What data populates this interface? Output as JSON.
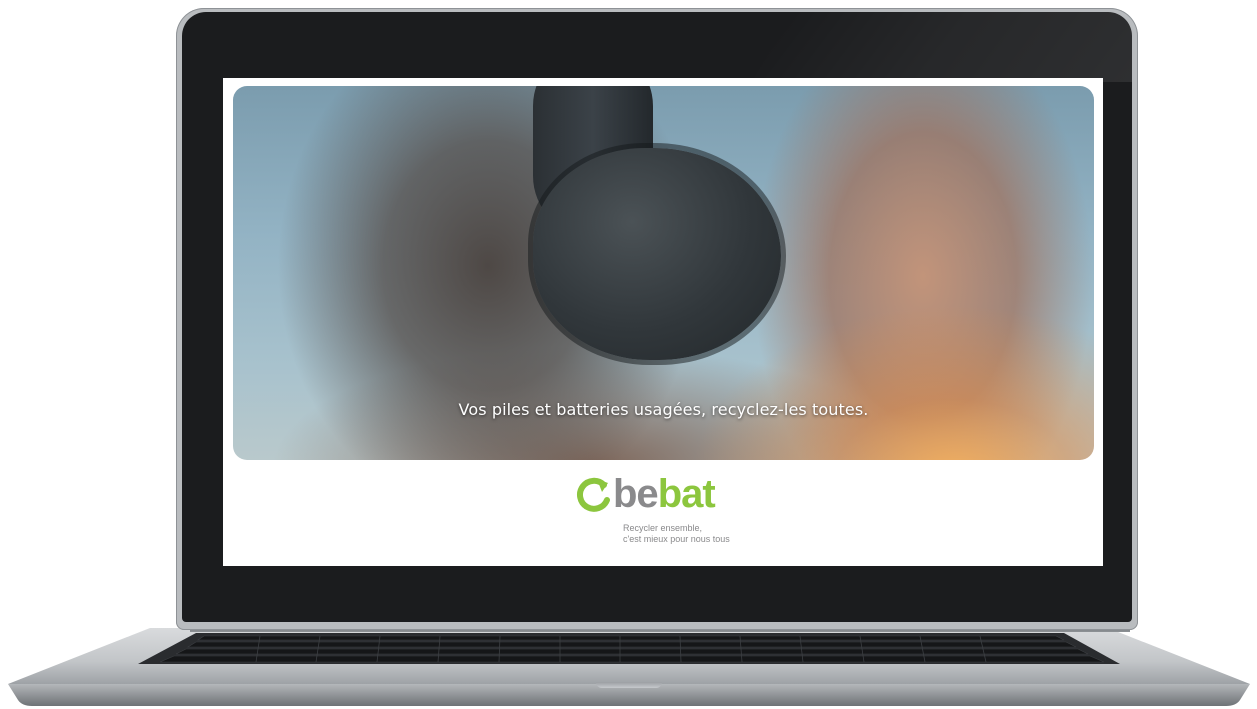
{
  "video": {
    "subtitle": "Vos piles et batteries usagées, recyclez-les toutes."
  },
  "brand": {
    "name_part1": "be",
    "name_part2": "bat",
    "tagline_line1": "Recycler ensemble,",
    "tagline_line2": "c'est mieux pour nous tous",
    "logo_icon": "recycle-arrow-icon",
    "colors": {
      "green": "#8cc63e",
      "gray": "#8a8a8c"
    }
  }
}
